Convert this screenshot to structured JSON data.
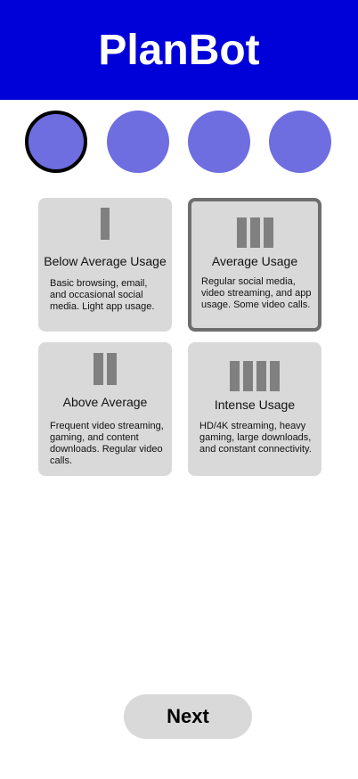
{
  "app": {
    "title": "PlanBot"
  },
  "colors": {
    "header_bg": "#0000d8",
    "step_dot": "#6e6ee0",
    "card_bg": "#d9d9d9",
    "bar": "#808080",
    "selected_border": "#6e6e6e"
  },
  "steps": {
    "count": 4,
    "active_index": 0
  },
  "usage_options": [
    {
      "title": "Below Average Usage",
      "description": "Basic browsing, email, and occasional social media. Light app usage.",
      "level": 1,
      "selected": false
    },
    {
      "title": "Average Usage",
      "description": "Regular social media, video streaming, and app usage. Some video calls.",
      "level": 3,
      "selected": true
    },
    {
      "title": "Above Average",
      "description": "Frequent video streaming, gaming, and content downloads. Regular video calls.",
      "level": 2,
      "selected": false
    },
    {
      "title": "Intense Usage",
      "description": "HD/4K streaming, heavy gaming, large downloads, and constant connectivity.",
      "level": 4,
      "selected": false
    }
  ],
  "footer": {
    "next_label": "Next"
  }
}
